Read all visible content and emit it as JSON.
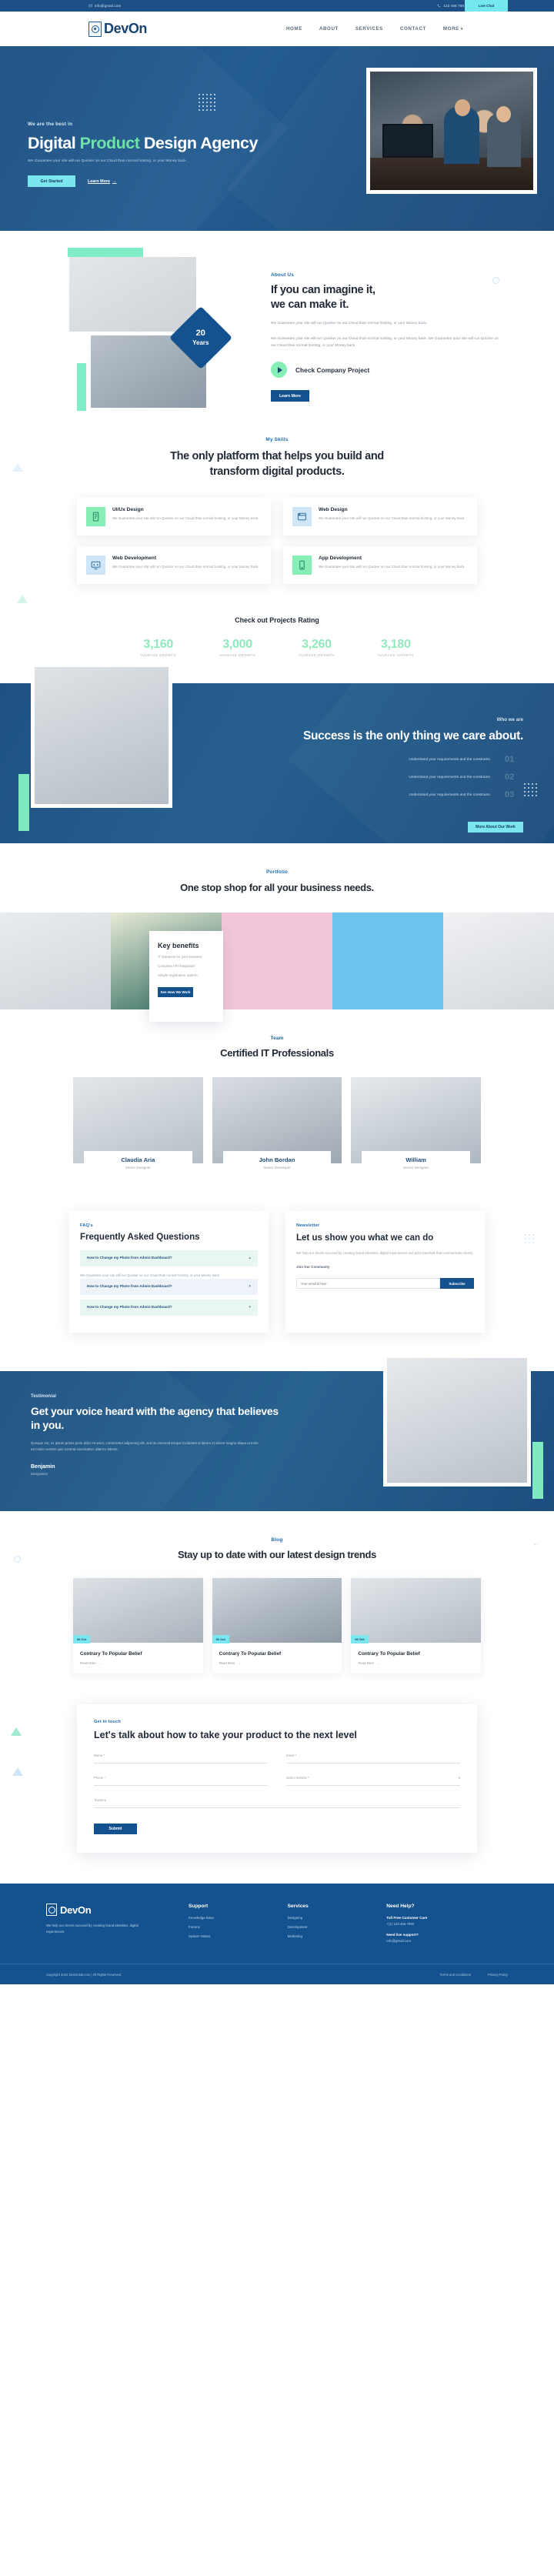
{
  "topbar": {
    "email": "info@gmail.com",
    "phone": "123 456 789",
    "live_chat": "Live Chat",
    "mail_icon": "mail-icon",
    "phone_icon": "phone-icon"
  },
  "nav": {
    "brand": "DevOn",
    "brand_icon": "devon-logo-icon",
    "links": [
      {
        "label": "HOME"
      },
      {
        "label": "ABOUT"
      },
      {
        "label": "SERVICES"
      },
      {
        "label": "CONTACT"
      },
      {
        "label": "MORE",
        "caret": "▾"
      }
    ]
  },
  "hero": {
    "eyebrow": "We are the best in",
    "title_part1": "Digital ",
    "title_accent": "Product",
    "title_part2": " Design Agency",
    "subtitle": "We Guarantee your site will run Quicker on our Cloud than normal hosting, or your Money back.",
    "primary_button": "Get Started",
    "secondary_link": "Learn More",
    "arrow_icon": "arrow-right-icon",
    "dots_icon": "dot-grid-decoration"
  },
  "about": {
    "kicker": "About Us",
    "title_line1": "If you can imagine it,",
    "title_line2": "we can make it.",
    "paragraph1": "We Guarantee your site will run Quicker on our Cloud than normal hosting, or your Money back.",
    "paragraph2": "We Guarantee your site will run Quicker on our Cloud than normal hosting, or your Money back. We Guarantee your site will run Quicker on our Cloud than normal hosting, or your Money back.",
    "play_label": "Check Company Project",
    "play_icon": "play-icon",
    "button": "Learn More",
    "badge_number": "20",
    "badge_text": "Years"
  },
  "skills": {
    "kicker": "My Skills",
    "title": "The only platform that helps you build and transform digital products.",
    "cards": [
      {
        "icon": "mobile-ui-icon",
        "title": "UI/Ux Design",
        "text": "We Guarantee your site will run Quicker on our Cloud than normal hosting, or your Money back."
      },
      {
        "icon": "browser-window-icon",
        "title": "Web Design",
        "text": "We Guarantee your site will run Quicker on our Cloud than normal hosting, or your Money back."
      },
      {
        "icon": "code-monitor-icon",
        "title": "Web Development",
        "text": "We Guarantee your site will run Quicker on our Cloud than normal hosting, or your Money back."
      },
      {
        "icon": "smartphone-icon",
        "title": "App Development",
        "text": "We Guarantee your site will run Quicker on our Cloud than normal hosting, or your Money back."
      }
    ]
  },
  "rating": {
    "title": "Check out Projects Rating",
    "stats": [
      {
        "value": "3,160",
        "label": "AVARAGE GROWTH"
      },
      {
        "value": "3,000",
        "label": "AVARAGE GROWTH"
      },
      {
        "value": "3,260",
        "label": "AVARAGE GROWTH"
      },
      {
        "value": "3,180",
        "label": "AVARAGE GROWTH"
      }
    ]
  },
  "success": {
    "kicker": "Who we are",
    "title": "Success is the only thing we care about.",
    "items": [
      {
        "text": "Understand your requirements and the constrains.",
        "number": "01"
      },
      {
        "text": "Understand your requirements and the constrains.",
        "number": "02"
      },
      {
        "text": "Understand your requirements and the constrains.",
        "number": "03"
      }
    ],
    "button": "More About Our Work"
  },
  "portfolio": {
    "kicker": "Portfolio",
    "title": "One stop shop for all your business needs.",
    "key_benefits": {
      "title": "Key benefits",
      "items": [
        "IT Solutions for your business",
        "Complete API integration",
        "Simple registration system"
      ],
      "button": "See How We Work"
    }
  },
  "team": {
    "kicker": "Team",
    "title": "Certified IT Professionals",
    "members": [
      {
        "name": "Claudia Aria",
        "role": "Senior Designer"
      },
      {
        "name": "John Bordan",
        "role": "Senior Developer"
      },
      {
        "name": "William",
        "role": "Senior Designer"
      }
    ]
  },
  "faq": {
    "kicker": "FAQ's",
    "title": "Frequently Asked Questions",
    "items": [
      {
        "question": "How to Change my Photo from Admin Dashboard?",
        "caret": "▴"
      },
      {
        "question": "How to Change my Photo from Admin Dashboard?",
        "caret": "▾"
      },
      {
        "question": "How to Change my Photo from Admin Dashboard?",
        "caret": "▾"
      }
    ],
    "answer": "We Guarantee your site will run Quicker on our Cloud than normal hosting, or your Money back."
  },
  "newsletter": {
    "kicker": "Newsletter",
    "title": "Let us show you what we can do",
    "text": "We help our clients succeed by creating brand identities, digital experiences and print materials that communicate clearly.",
    "join_label": "Join Our Community",
    "placeholder": "Your email id here",
    "button": "Subscribe"
  },
  "testimonial": {
    "kicker": "Testimonial",
    "title": "Get your voice heard with the agency that believes in you.",
    "quote": "Quisque est, ex ipsum primis proin dolor sit amet, consectetur adipiscing elit, sed do eiusmod tempor incididunt ut labore et dolore magna aliqua ut enim ad minim veniam quis nostrud exercitation ullamco laboris.",
    "name": "Benjamin",
    "role": "Designation"
  },
  "blog": {
    "kicker": "Blog",
    "title": "Stay up to date with our latest design trends",
    "posts": [
      {
        "date": "06 Oct",
        "title": "Contrary To Popular Belief",
        "more": "Read More"
      },
      {
        "date": "06 Oct",
        "title": "Contrary To Popular Belief",
        "more": "Read More"
      },
      {
        "date": "06 Oct",
        "title": "Contrary To Popular Belief",
        "more": "Read More"
      }
    ]
  },
  "contact": {
    "kicker": "Get In touch",
    "title": "Let's talk about how to take your product to the next level",
    "fields": [
      {
        "label": "Name *"
      },
      {
        "label": "Email *"
      },
      {
        "label": "Phone *"
      },
      {
        "label": "Select Service *",
        "select": true
      },
      {
        "label": "Textarea"
      }
    ],
    "button": "Submit"
  },
  "footer": {
    "brand": "DevOn",
    "description": "We help our clients succeed by creating brand identities, digital experiences.",
    "columns": [
      {
        "title": "Support",
        "items": [
          "Knowledge Base",
          "Forums",
          "System Status"
        ]
      },
      {
        "title": "Services",
        "items": [
          "Designing",
          "Development",
          "Marketing"
        ]
      }
    ],
    "help": {
      "title": "Need Help?",
      "care_label": "Toll Free Customer Care",
      "care_value": "+(1) 123 456 7890",
      "support_label": "Need live support?",
      "support_value": "Info@gmail.com"
    },
    "copyright": "Copyright 2022 DevOnlab.com | All Rights Reserved.",
    "links": [
      {
        "label": "Terms and Conditions"
      },
      {
        "label": "Privacy Policy"
      }
    ]
  }
}
